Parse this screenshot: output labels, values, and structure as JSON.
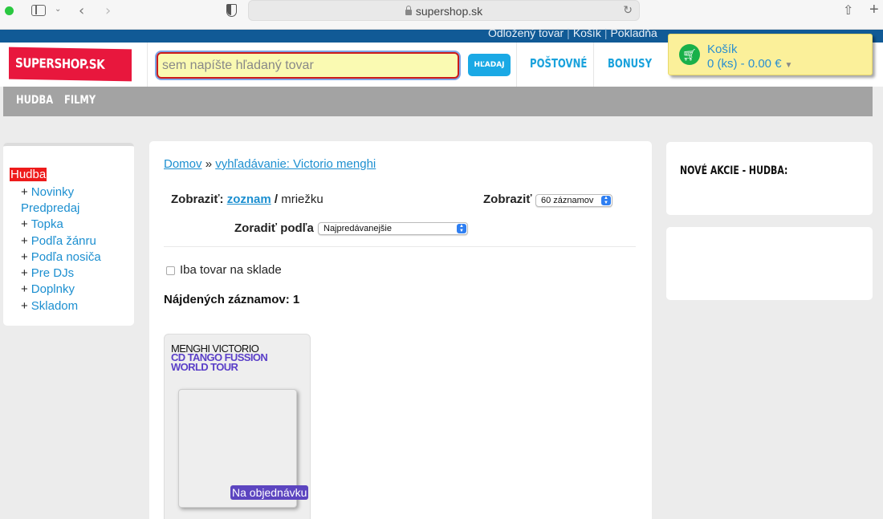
{
  "browser": {
    "url": "supershop.sk",
    "back_icon": "‹",
    "forward_icon": "›",
    "reload_icon": "↻",
    "share_icon": "⇧",
    "newtab_icon": "+"
  },
  "top_links": [
    "Odložený tovar",
    "Košík",
    "Pokladňa"
  ],
  "header": {
    "logo": "SUPERSHOP.SK",
    "search_placeholder": "sem napíšte hľadaný tovar",
    "search_button": "HĽADAJ",
    "nav": [
      "POŠTOVNÉ",
      "BONUSY"
    ]
  },
  "cart": {
    "title": "Košík",
    "info": "0 (ks) - 0.00 €"
  },
  "categories": [
    "HUDBA",
    "FILMY"
  ],
  "sidebar": {
    "heading": "Hudba",
    "items": [
      {
        "plus": "+",
        "label": "Novinky"
      },
      {
        "plus": "",
        "label": "Predpredaj"
      },
      {
        "plus": "+",
        "label": "Topka"
      },
      {
        "plus": "+",
        "label": "Podľa žánru"
      },
      {
        "plus": "+",
        "label": "Podľa nosiča"
      },
      {
        "plus": "+",
        "label": "Pre DJs"
      },
      {
        "plus": "+",
        "label": "Doplnky"
      },
      {
        "plus": "+",
        "label": "Skladom"
      }
    ]
  },
  "main": {
    "breadcrumb_home": "Domov",
    "breadcrumb_sep": "»",
    "breadcrumb_current": "vyhľadávanie: Victorio menghi",
    "view_label": "Zobraziť:",
    "view_list": "zoznam",
    "view_sep": "/",
    "view_grid": "mriežku",
    "show_label": "Zobraziť",
    "show_value": "60 záznamov",
    "sort_label": "Zoradiť podľa",
    "sort_value": "Najpredávanejšie",
    "instock_label": "Iba tovar na sklade",
    "found": "Nájdených záznamov: 1"
  },
  "product": {
    "artist": "MENGHI VICTORIO",
    "title": "CD TANGO FUSSION WORLD TOUR",
    "badge": "Na objednávku"
  },
  "right": {
    "promo_title": "NOVÉ AKCIE - HUDBA:"
  }
}
